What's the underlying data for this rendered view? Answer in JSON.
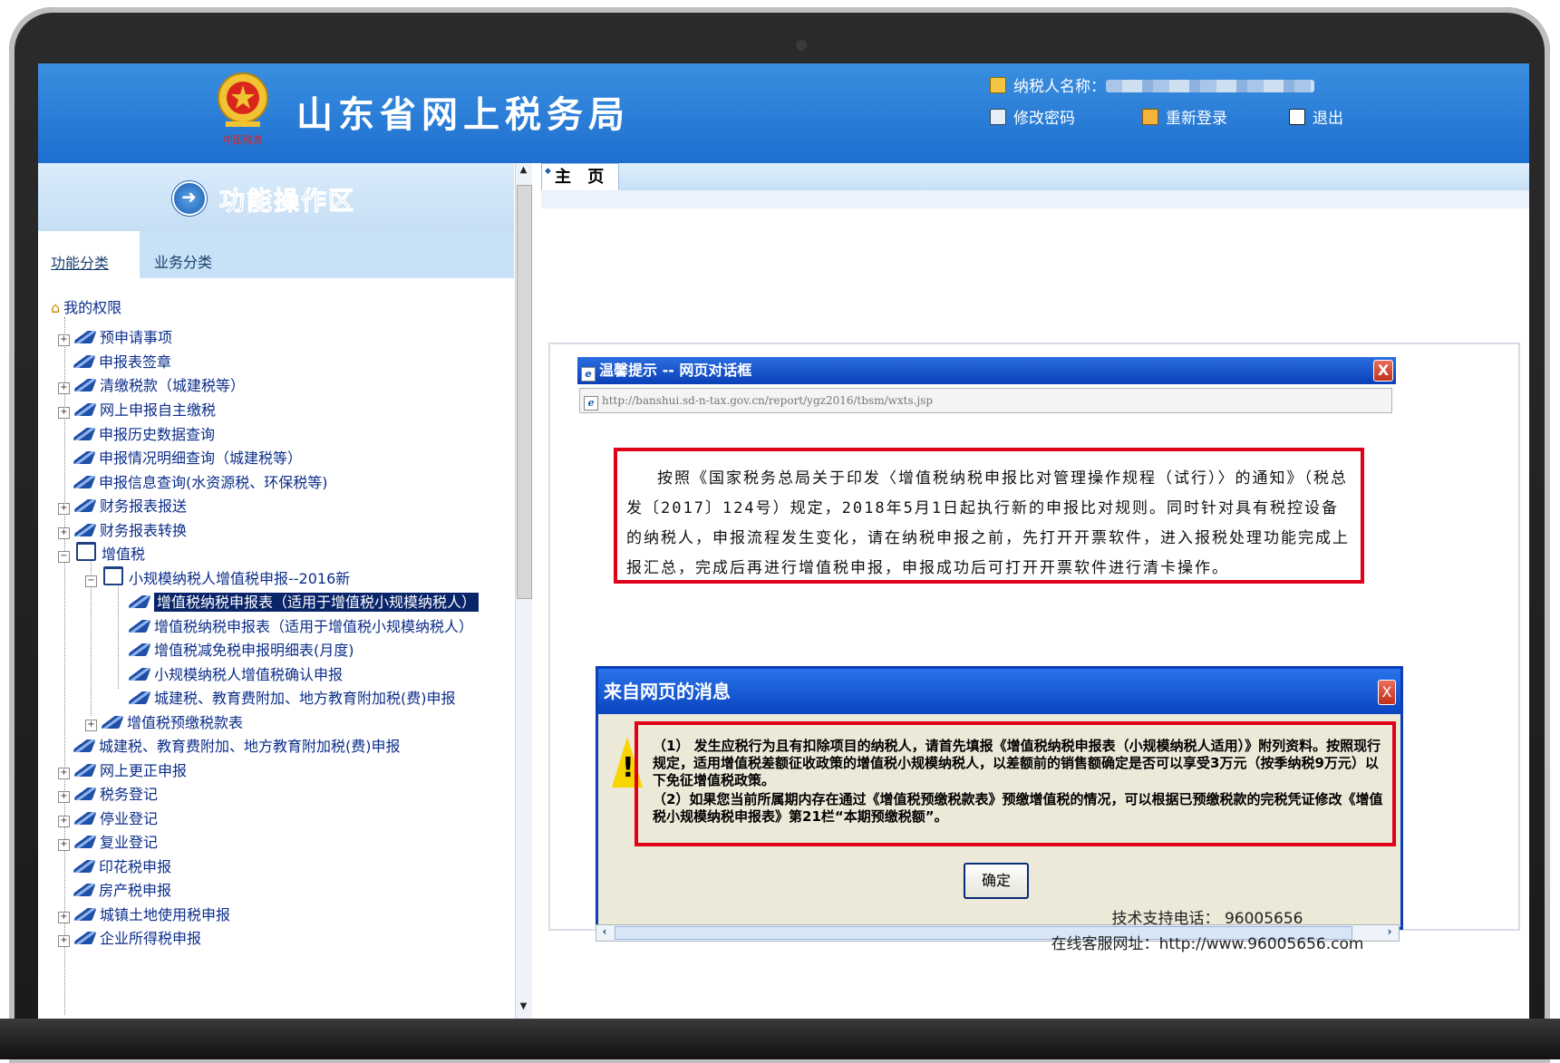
{
  "header": {
    "site_title": "山东省网上税务局",
    "taxpayer_label": "纳税人名称：",
    "change_password": "修改密码",
    "relogin": "重新登录",
    "logout": "退出"
  },
  "sidebar": {
    "title": "功能操作区",
    "tabs": [
      "功能分类",
      "业务分类"
    ],
    "root": "我的权限",
    "items": [
      "预申请事项",
      "申报表签章",
      "清缴税款（城建税等）",
      "网上申报自主缴税",
      "申报历史数据查询",
      "申报情况明细查询（城建税等）",
      "申报信息查询(水资源税、环保税等)",
      "财务报表报送",
      "财务报表转换",
      "增值税",
      "小规模纳税人增值税申报--2016新",
      "增值税纳税申报表（适用于增值税小规模纳税人）",
      "增值税纳税申报表（适用于增值税小规模纳税人）",
      "增值税减免税申报明细表(月度)",
      "小规模纳税人增值税确认申报",
      "城建税、教育费附加、地方教育附加税(费)申报",
      "增值税预缴税款表",
      "城建税、教育费附加、地方教育附加税(费)申报",
      "网上更正申报",
      "税务登记",
      "停业登记",
      "复业登记",
      "印花税申报",
      "房产税申报",
      "城镇土地使用税申报",
      "企业所得税申报"
    ]
  },
  "main": {
    "home_tab": "主 页",
    "dialog1": {
      "title": "温馨提示 -- 网页对话框",
      "url": "http://banshui.sd-n-tax.gov.cn/report/ygz2016/tbsm/wxts.jsp",
      "notice": "按照《国家税务总局关于印发〈增值税纳税申报比对管理操作规程（试行）〉的通知》（税总发〔2017〕124号）规定，2018年5月1日起执行新的申报比对规则。同时针对具有税控设备的纳税人，申报流程发生变化，请在纳税申报之前，先打开开票软件，进入报税处理功能完成上报汇总，完成后再进行增值税申报，申报成功后可打开开票软件进行清卡操作。",
      "close": "X"
    },
    "dialog2": {
      "title": "来自网页的消息",
      "message1": "（1） 发生应税行为且有扣除项目的纳税人，请首先填报《增值税纳税申报表（小规模纳税人适用）》附列资料。按照现行规定，适用增值税差额征收政策的增值税小规模纳税人，以差额前的销售额确定是否可以享受3万元（按季纳税9万元）以下免征增值税政策。",
      "message2": "（2）如果您当前所属期内存在通过《增值税预缴税款表》预缴增值税的情况，可以根据已预缴税款的完税凭证修改《增值税小规模纳税申报表》第21栏“本期预缴税额”。",
      "ok": "确定",
      "close": "X"
    },
    "footer": {
      "phone_label": "技术支持电话：",
      "phone": "96005656",
      "web_label": "在线客服网址：",
      "web": "http://www.96005656.com"
    }
  }
}
